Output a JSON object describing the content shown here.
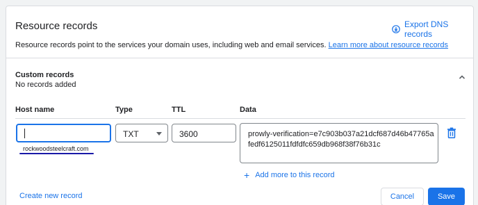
{
  "card": {
    "title": "Resource records",
    "export_label": "Export DNS records",
    "description": "Resource records point to the services your domain uses, including web and email services.",
    "learn_more": "Learn more about resource records"
  },
  "custom": {
    "title": "Custom records",
    "subtitle": "No records added",
    "columns": {
      "host": "Host name",
      "type": "Type",
      "ttl": "TTL",
      "data": "Data"
    },
    "row": {
      "host_value": "",
      "domain_suffix": "rockwoodsteelcraft.com",
      "type_value": "TXT",
      "ttl_value": "3600",
      "data_value": "prowly-verification=e7c903b037a21dcf687d46b47765afedf6125011fdfdfc659db968f38f76b31c"
    },
    "add_more": "Add more to this record",
    "create_new": "Create new record",
    "cancel": "Cancel",
    "save": "Save"
  },
  "colors": {
    "accent": "#1a73e8",
    "annotation_underline": "#1a1aa8"
  },
  "icons": {
    "export": "download-circle-icon",
    "collapse": "chevron-up-icon",
    "type_dropdown": "caret-down-icon",
    "delete": "trash-icon",
    "add": "plus-icon"
  }
}
